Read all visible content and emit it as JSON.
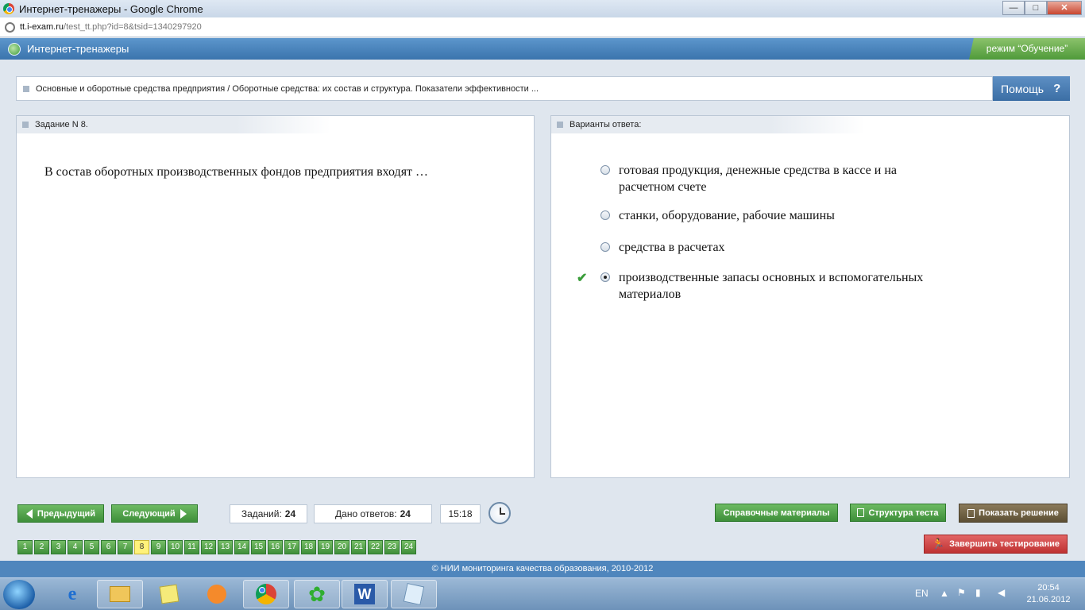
{
  "window": {
    "title": "Интернет-тренажеры - Google Chrome",
    "minimize": "—",
    "maximize": "□",
    "close": "✕"
  },
  "address": {
    "host": "tt.i-exam.ru",
    "path": "/test_tt.php?id=8&tsid=1340297920"
  },
  "app": {
    "title": "Интернет-тренажеры",
    "mode": "режим “Обучение”"
  },
  "breadcrumb": "Основные и оборотные средства предприятия / Оборотные средства: их состав и структура. Показатели эффективности ...",
  "help": {
    "label": "Помощь",
    "mark": "?"
  },
  "task": {
    "header": "Задание N 8.",
    "question": "В состав оборотных производственных фондов предприятия входят …"
  },
  "answers": {
    "header": "Варианты ответа:",
    "items": [
      {
        "line1": "готовая продукция, денежные средства в кассе и на",
        "line2": "расчетном счете"
      },
      {
        "line1": "станки, оборудование, рабочие машины",
        "line2": ""
      },
      {
        "line1": "средства в расчетах",
        "line2": ""
      },
      {
        "line1": "производственные запасы основных и вспомогательных",
        "line2": "материалов"
      }
    ],
    "selected_index": 3,
    "check_mark": "✔"
  },
  "toolbar": {
    "prev": "Предыдущий",
    "next": "Следующий",
    "tasks_label": "Заданий:",
    "tasks_value": "24",
    "answered_label": "Дано ответов:",
    "answered_value": "24",
    "timer": "15:18",
    "reference": "Справочные материалы",
    "structure": "Структура теста",
    "show_solution": "Показать решение",
    "finish": "Завершить тестирование"
  },
  "pages": [
    "1",
    "2",
    "3",
    "4",
    "5",
    "6",
    "7",
    "8",
    "9",
    "10",
    "11",
    "12",
    "13",
    "14",
    "15",
    "16",
    "17",
    "18",
    "19",
    "20",
    "21",
    "22",
    "23",
    "24"
  ],
  "current_page": "8",
  "footer": "© НИИ мониторинга качества образования, 2010-2012",
  "taskbar": {
    "lang": "EN",
    "time": "20:54",
    "date": "21.06.2012"
  }
}
